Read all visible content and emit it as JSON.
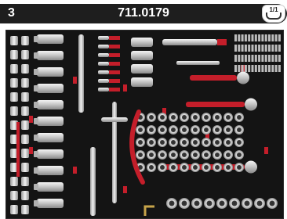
{
  "header": {
    "drawer_number": "3",
    "item_code": "711.0179",
    "drawer_badge": "1/1"
  },
  "colors": {
    "header_bg": "#1e1e1e",
    "foam": "#141414",
    "accent": "#c41e2a",
    "chrome": "#d4d4d4"
  },
  "icons": {
    "drawer_badge_icon": "drawer-tray-icon"
  }
}
